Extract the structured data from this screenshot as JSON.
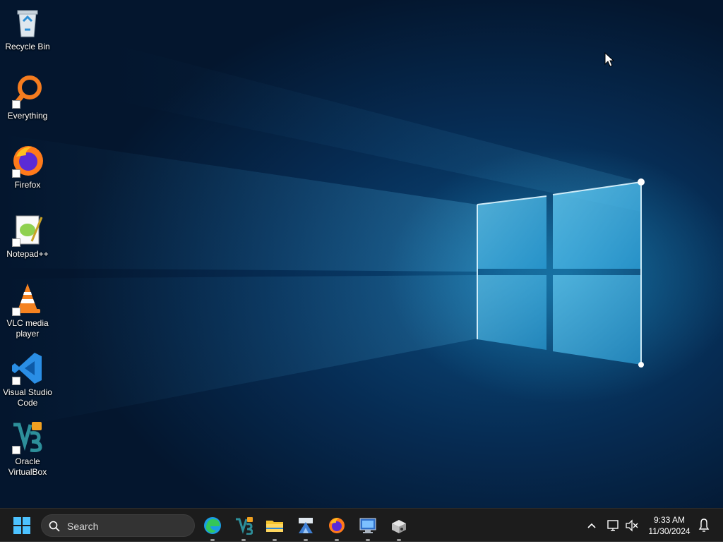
{
  "desktop": {
    "icons": [
      {
        "label": "Recycle Bin",
        "icon": "recycle-bin-icon",
        "shortcut": false
      },
      {
        "label": "Everything",
        "icon": "everything-icon",
        "shortcut": true
      },
      {
        "label": "Firefox",
        "icon": "firefox-icon",
        "shortcut": true
      },
      {
        "label": "Notepad++",
        "icon": "notepadpp-icon",
        "shortcut": true
      },
      {
        "label": "VLC media player",
        "icon": "vlc-icon",
        "shortcut": true
      },
      {
        "label": "Visual Studio Code",
        "icon": "vscode-icon",
        "shortcut": true
      },
      {
        "label": "Oracle VirtualBox",
        "icon": "virtualbox-icon",
        "shortcut": true
      }
    ]
  },
  "taskbar": {
    "search_placeholder": "Search",
    "apps": [
      "edge-icon",
      "virtualbox-icon",
      "file-explorer-icon",
      "app-icon",
      "firefox-icon",
      "remote-desktop-icon",
      "media-app-icon"
    ]
  },
  "tray": {
    "time": "9:33 AM",
    "date": "11/30/2024"
  },
  "colors": {
    "taskbar": "#1c1c1c",
    "search_bg": "#333333",
    "wallpaper": "#0b4b7e"
  }
}
